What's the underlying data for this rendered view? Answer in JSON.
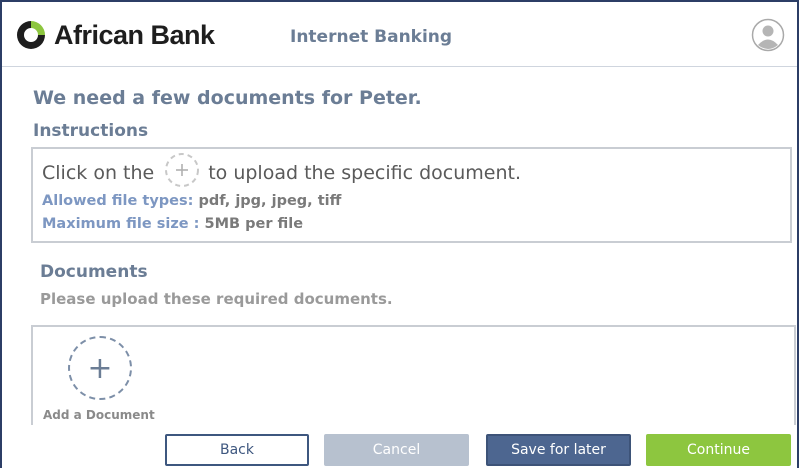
{
  "header": {
    "brand": "African Bank",
    "app_title": "Internet Banking",
    "logo_icon": "african-bank-logo-icon",
    "avatar_icon": "user-avatar-icon"
  },
  "page": {
    "heading": "We need a few documents for Peter."
  },
  "instructions": {
    "label": "Instructions",
    "line_before": "Click on the",
    "line_after": "to upload the specific document.",
    "file_types_key": "Allowed file types:",
    "file_types_value": "pdf, jpg, jpeg, tiff",
    "max_size_key": "Maximum file size :",
    "max_size_value": "5MB per file"
  },
  "documents": {
    "label": "Documents",
    "subtitle": "Please upload these required documents.",
    "add_label": "Add a Document"
  },
  "actions": {
    "back": "Back",
    "cancel": "Cancel",
    "save": "Save for later",
    "continue": "Continue"
  },
  "colors": {
    "primary": "#4d6690",
    "accent_green": "#8dc63f",
    "text_muted": "#6b7d95",
    "disabled": "#b7c1cf"
  }
}
